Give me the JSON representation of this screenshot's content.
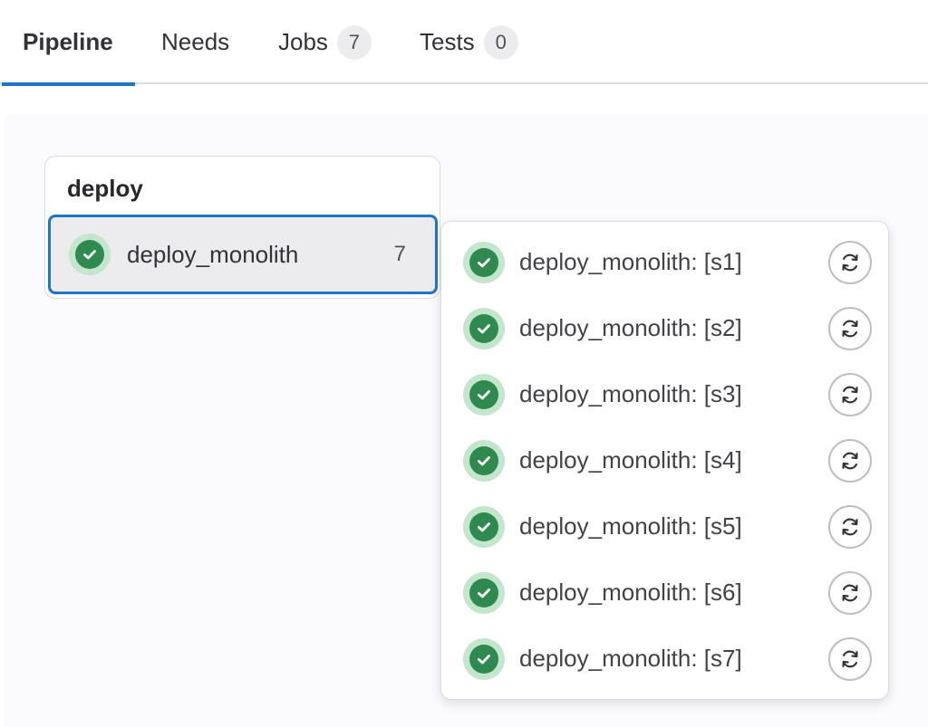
{
  "tabs": [
    {
      "label": "Pipeline",
      "count": null
    },
    {
      "label": "Needs",
      "count": null
    },
    {
      "label": "Jobs",
      "count": "7"
    },
    {
      "label": "Tests",
      "count": "0"
    }
  ],
  "stage": {
    "title": "deploy",
    "job": {
      "name": "deploy_monolith",
      "count": "7",
      "status": "success"
    }
  },
  "dropdown": {
    "items": [
      {
        "name": "deploy_monolith: [s1]",
        "status": "success"
      },
      {
        "name": "deploy_monolith: [s2]",
        "status": "success"
      },
      {
        "name": "deploy_monolith: [s3]",
        "status": "success"
      },
      {
        "name": "deploy_monolith: [s4]",
        "status": "success"
      },
      {
        "name": "deploy_monolith: [s5]",
        "status": "success"
      },
      {
        "name": "deploy_monolith: [s6]",
        "status": "success"
      },
      {
        "name": "deploy_monolith: [s7]",
        "status": "success"
      }
    ]
  },
  "colors": {
    "accent": "#1f75cb",
    "success": "#2f8a4f",
    "success_ring": "#c3e6cd"
  },
  "icons": {
    "status": "check-circle-icon",
    "retry": "retry-icon"
  }
}
